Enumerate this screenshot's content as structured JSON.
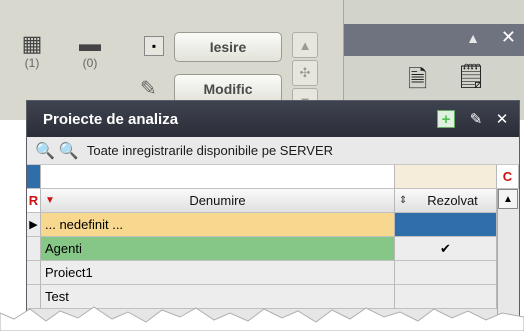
{
  "toolbar": {
    "tool1_label": "(1)",
    "tool2_label": "(0)",
    "exit_label": "Iesire",
    "edit_label": "Modific"
  },
  "dialog": {
    "title": "Proiecte de analiza",
    "search_text": "Toate inregistrarile disponibile pe SERVER"
  },
  "grid": {
    "red_marker": "R",
    "right_marker": "C",
    "col_name": "Denumire",
    "col_resolved": "Rezolvat",
    "rows": [
      {
        "name": "... nedefinit ...",
        "resolved": "",
        "current": true
      },
      {
        "name": "Agenti",
        "resolved": "✔",
        "current": false
      },
      {
        "name": "Proiect1",
        "resolved": "",
        "current": false
      },
      {
        "name": "Test",
        "resolved": "",
        "current": false
      }
    ]
  },
  "colors": {
    "title_bar": "#33363f",
    "row_undefined": "#f7d88e",
    "row_agenti": "#86c686",
    "resolved_highlight": "#2f6ea8"
  }
}
